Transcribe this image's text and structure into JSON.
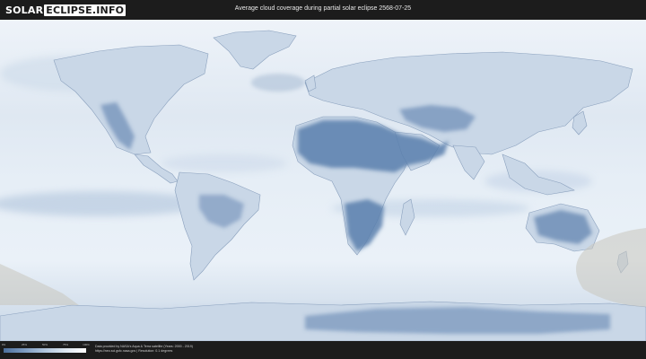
{
  "header": {
    "logo_part1": "SOLAR",
    "logo_part2": "ECLIPSE.INFO",
    "title": "Average cloud coverage during partial solar eclipse 2568-07-25"
  },
  "legend": {
    "ticks": [
      "0%",
      "25%",
      "50%",
      "75%",
      "100%"
    ],
    "colors": [
      "#4d6f9c",
      "#7d9bc1",
      "#b0c5dd",
      "#dde7f1",
      "#ffffff"
    ]
  },
  "credits": {
    "line1": "Data provided by NASA's Aqua & Terra satellite (Years: 2000 - 2019)",
    "line2": "https://neo.sci.gsfc.nasa.gov | Resolution: 0.1 degrees"
  },
  "colors": {
    "background": "#1c1c1c",
    "clear_sky": "#e9f0f7",
    "low_cloud_land": "#5b7fad",
    "coastline": "#8aa0bd",
    "eclipse_shadow": "#c9c6bd"
  }
}
